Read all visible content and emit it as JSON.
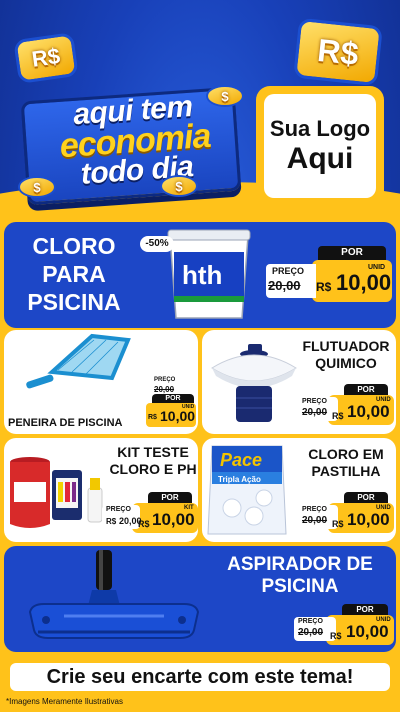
{
  "header": {
    "coin_symbol": "R$",
    "headline": [
      "aqui tem",
      "economia",
      "todo dia"
    ],
    "logo": [
      "Sua Logo",
      "Aqui"
    ]
  },
  "products": [
    {
      "id": "cloro",
      "title": [
        "CLORO",
        "PARA",
        "PSICINA"
      ],
      "discount_badge": "-50%",
      "brand": "hth",
      "price": {
        "por": "POR",
        "preco": "PREÇO",
        "old": "20,00",
        "currency": "R$",
        "value": "10,00",
        "unit": "UNID"
      }
    },
    {
      "id": "peneira",
      "title": [
        "PENEIRA DE PISCINA"
      ],
      "price": {
        "por": "POR",
        "preco": "PREÇO",
        "old": "20,00",
        "currency": "R$",
        "value": "10,00",
        "unit": "UNID"
      }
    },
    {
      "id": "flutuador",
      "title": [
        "FLUTUADOR",
        "QUIMICO"
      ],
      "price": {
        "por": "POR",
        "preco": "PREÇO",
        "old": "20,00",
        "currency": "R$",
        "value": "10,00",
        "unit": "UNID"
      }
    },
    {
      "id": "kit",
      "title": [
        "KIT TESTE",
        "CLORO E PH"
      ],
      "price": {
        "por": "POR",
        "preco": "PREÇO",
        "old": "20,00",
        "currency": "R$",
        "value": "10,00",
        "unit": "KIT"
      }
    },
    {
      "id": "pastilha",
      "title": [
        "CLORO EM",
        "PASTILHA"
      ],
      "brand": "Pace",
      "pack_text": "Tripla Ação",
      "price": {
        "por": "POR",
        "preco": "PREÇO",
        "old": "20,00",
        "currency": "R$",
        "value": "10,00",
        "unit": "UNID"
      }
    },
    {
      "id": "aspirador",
      "title": [
        "ASPIRADOR DE",
        "PSICINA"
      ],
      "price": {
        "por": "POR",
        "preco": "PREÇO",
        "old": "20,00",
        "currency": "R$",
        "value": "10,00",
        "unit": "UNID"
      }
    }
  ],
  "cta": "Crie seu encarte com este tema!",
  "footnote": "*Imagens Meramente Ilustrativas",
  "colors": {
    "blue": "#1d47c7",
    "yellow": "#ffc21a",
    "black": "#111111"
  }
}
